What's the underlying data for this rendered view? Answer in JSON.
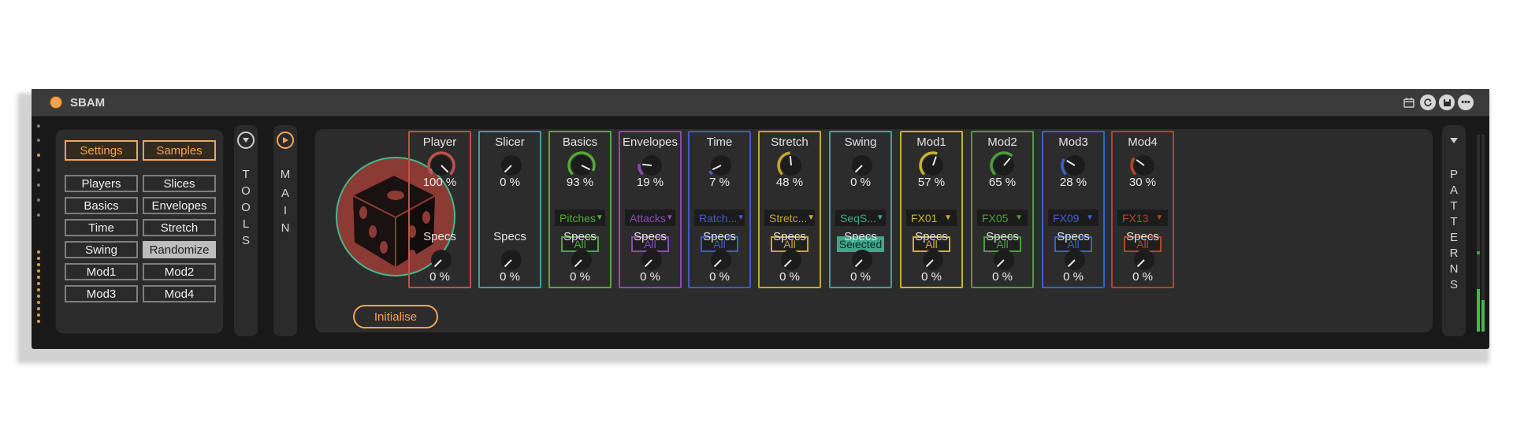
{
  "device": {
    "title": "SBAM"
  },
  "titlebar_icons": [
    "calendar-icon",
    "refresh-icon",
    "save-icon",
    "more-icon"
  ],
  "left_panel": {
    "top_buttons": [
      {
        "label": "Settings",
        "style": "orange"
      },
      {
        "label": "Samples",
        "style": "orange"
      }
    ],
    "grid_buttons": [
      {
        "label": "Players",
        "selected": false
      },
      {
        "label": "Slices",
        "selected": false
      },
      {
        "label": "Basics",
        "selected": false
      },
      {
        "label": "Envelopes",
        "selected": false
      },
      {
        "label": "Time",
        "selected": false
      },
      {
        "label": "Stretch",
        "selected": false
      },
      {
        "label": "Swing",
        "selected": false
      },
      {
        "label": "Randomize",
        "selected": true
      },
      {
        "label": "Mod1",
        "selected": false
      },
      {
        "label": "Mod2",
        "selected": false
      },
      {
        "label": "Mod3",
        "selected": false
      },
      {
        "label": "Mod4",
        "selected": false
      }
    ]
  },
  "tools_strip": {
    "letters": [
      "T",
      "O",
      "O",
      "L",
      "S"
    ],
    "icon": "chevron-down-icon"
  },
  "main_strip": {
    "letters": [
      "M",
      "A",
      "I",
      "N"
    ],
    "icon": "play-icon"
  },
  "patterns_strip": {
    "letters": [
      "P",
      "A",
      "T",
      "T",
      "E",
      "R",
      "N",
      "S"
    ],
    "icon": "chevron-down-icon"
  },
  "main": {
    "dice_icon": "dice-icon",
    "initialise_label": "Initialise",
    "modules": [
      {
        "name": "Player",
        "color": "#c0504a",
        "value": "100 %",
        "level": 1.0,
        "dropdown": null,
        "all": null,
        "specs_label": "Specs",
        "specs_value": "0 %"
      },
      {
        "name": "Slicer",
        "color": "#3f9ea0",
        "value": "0 %",
        "level": 0.0,
        "dropdown": null,
        "all": null,
        "specs_label": "Specs",
        "specs_value": "0 %"
      },
      {
        "name": "Basics",
        "color": "#54a83a",
        "value": "93 %",
        "level": 0.93,
        "dropdown": "Pitches",
        "all": "All",
        "specs_label": "Specs",
        "specs_value": "0 %"
      },
      {
        "name": "Envelopes",
        "color": "#8a4bb5",
        "value": "19 %",
        "level": 0.19,
        "dropdown": "Attacks",
        "all": "All",
        "specs_label": "Specs",
        "specs_value": "0 %"
      },
      {
        "name": "Time",
        "color": "#4559c8",
        "value": "7 %",
        "level": 0.07,
        "dropdown": "Ratch...",
        "all": "All",
        "specs_label": "Specs",
        "specs_value": "0 %"
      },
      {
        "name": "Stretch",
        "color": "#c6a82e",
        "value": "48 %",
        "level": 0.48,
        "dropdown": "Stretc...",
        "all": "All",
        "specs_label": "Specs",
        "specs_value": "0 %"
      },
      {
        "name": "Swing",
        "color": "#3fa68a",
        "value": "0 %",
        "level": 0.0,
        "dropdown": "SeqS...",
        "all": "Selected",
        "all_filled": true,
        "specs_label": "Specs",
        "specs_value": "0 %"
      },
      {
        "name": "Mod1",
        "color": "#c9b22e",
        "value": "57 %",
        "level": 0.57,
        "dropdown": "FX01",
        "all": "All",
        "specs_label": "Specs",
        "specs_value": "0 %"
      },
      {
        "name": "Mod2",
        "color": "#4aa03a",
        "value": "65 %",
        "level": 0.65,
        "dropdown": "FX05",
        "all": "All",
        "specs_label": "Specs",
        "specs_value": "0 %"
      },
      {
        "name": "Mod3",
        "color": "#3b5fd0",
        "value": "28 %",
        "level": 0.28,
        "dropdown": "FX09",
        "all": "All",
        "specs_label": "Specs",
        "specs_value": "0 %"
      },
      {
        "name": "Mod4",
        "color": "#b84422",
        "value": "30 %",
        "level": 0.3,
        "dropdown": "FX13",
        "all": "All",
        "specs_label": "Specs",
        "specs_value": "0 %"
      }
    ]
  }
}
